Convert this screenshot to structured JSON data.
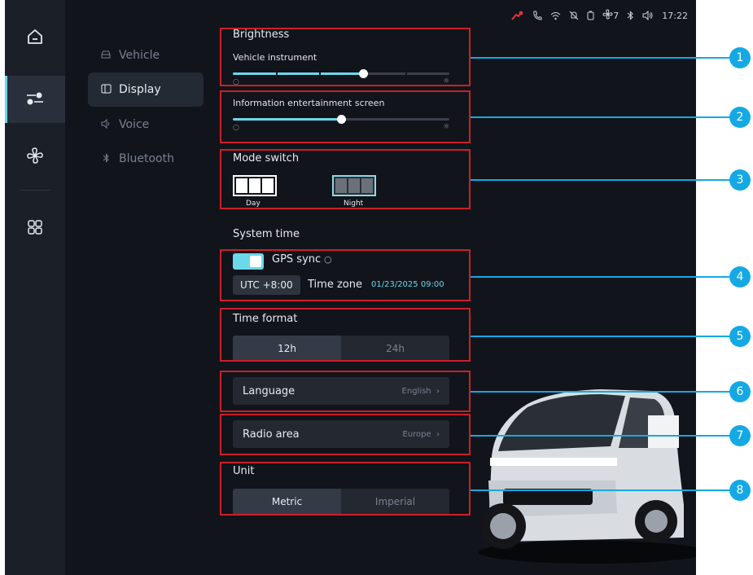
{
  "status_bar": {
    "icons": [
      "pedestrian-alert-icon",
      "phone-icon",
      "wifi-icon",
      "bell-off-icon",
      "battery-icon",
      "fan-icon",
      "bluetooth-icon",
      "volume-icon"
    ],
    "fan_level": "7",
    "time": "17:22"
  },
  "rail": {
    "items": [
      {
        "icon": "home-icon"
      },
      {
        "icon": "settings-sliders-icon",
        "active": true
      },
      {
        "icon": "fan-icon"
      },
      {
        "icon": "apps-grid-icon"
      }
    ]
  },
  "nav": {
    "items": [
      {
        "label": "Vehicle",
        "icon": "car-icon"
      },
      {
        "label": "Display",
        "icon": "display-icon",
        "active": true
      },
      {
        "label": "Voice",
        "icon": "speaker-icon"
      },
      {
        "label": "Bluetooth",
        "icon": "bluetooth-icon"
      }
    ]
  },
  "brightness": {
    "title": "Brightness",
    "vehicle_instrument": {
      "label": "Vehicle instrument",
      "value_pct": 60
    },
    "infotainment": {
      "label": "Information  entertainment screen",
      "value_pct": 50
    }
  },
  "mode_switch": {
    "title": "Mode switch",
    "options": [
      "Day",
      "Night"
    ],
    "selected": "Night"
  },
  "system_time": {
    "title": "System time",
    "gps_sync_label": "GPS sync",
    "gps_sync_on": true,
    "utc_offset": "UTC +8:00",
    "time_zone_label": "Time zone",
    "datetime": "01/23/2025 09:00"
  },
  "time_format": {
    "title": "Time format",
    "options": [
      "12h",
      "24h"
    ],
    "selected": "12h"
  },
  "language": {
    "label": "Language",
    "value": "English"
  },
  "radio_area": {
    "label": "Radio area",
    "value": "Europe"
  },
  "unit": {
    "title": "Unit",
    "options": [
      "Metric",
      "Imperial"
    ],
    "selected": "Metric"
  },
  "callouts": [
    "1",
    "2",
    "3",
    "4",
    "5",
    "6",
    "7",
    "8"
  ],
  "colors": {
    "accent": "#6ad9ea",
    "highlight": "#cc1f28",
    "callout": "#14a9e4",
    "bg": "#11141b"
  }
}
